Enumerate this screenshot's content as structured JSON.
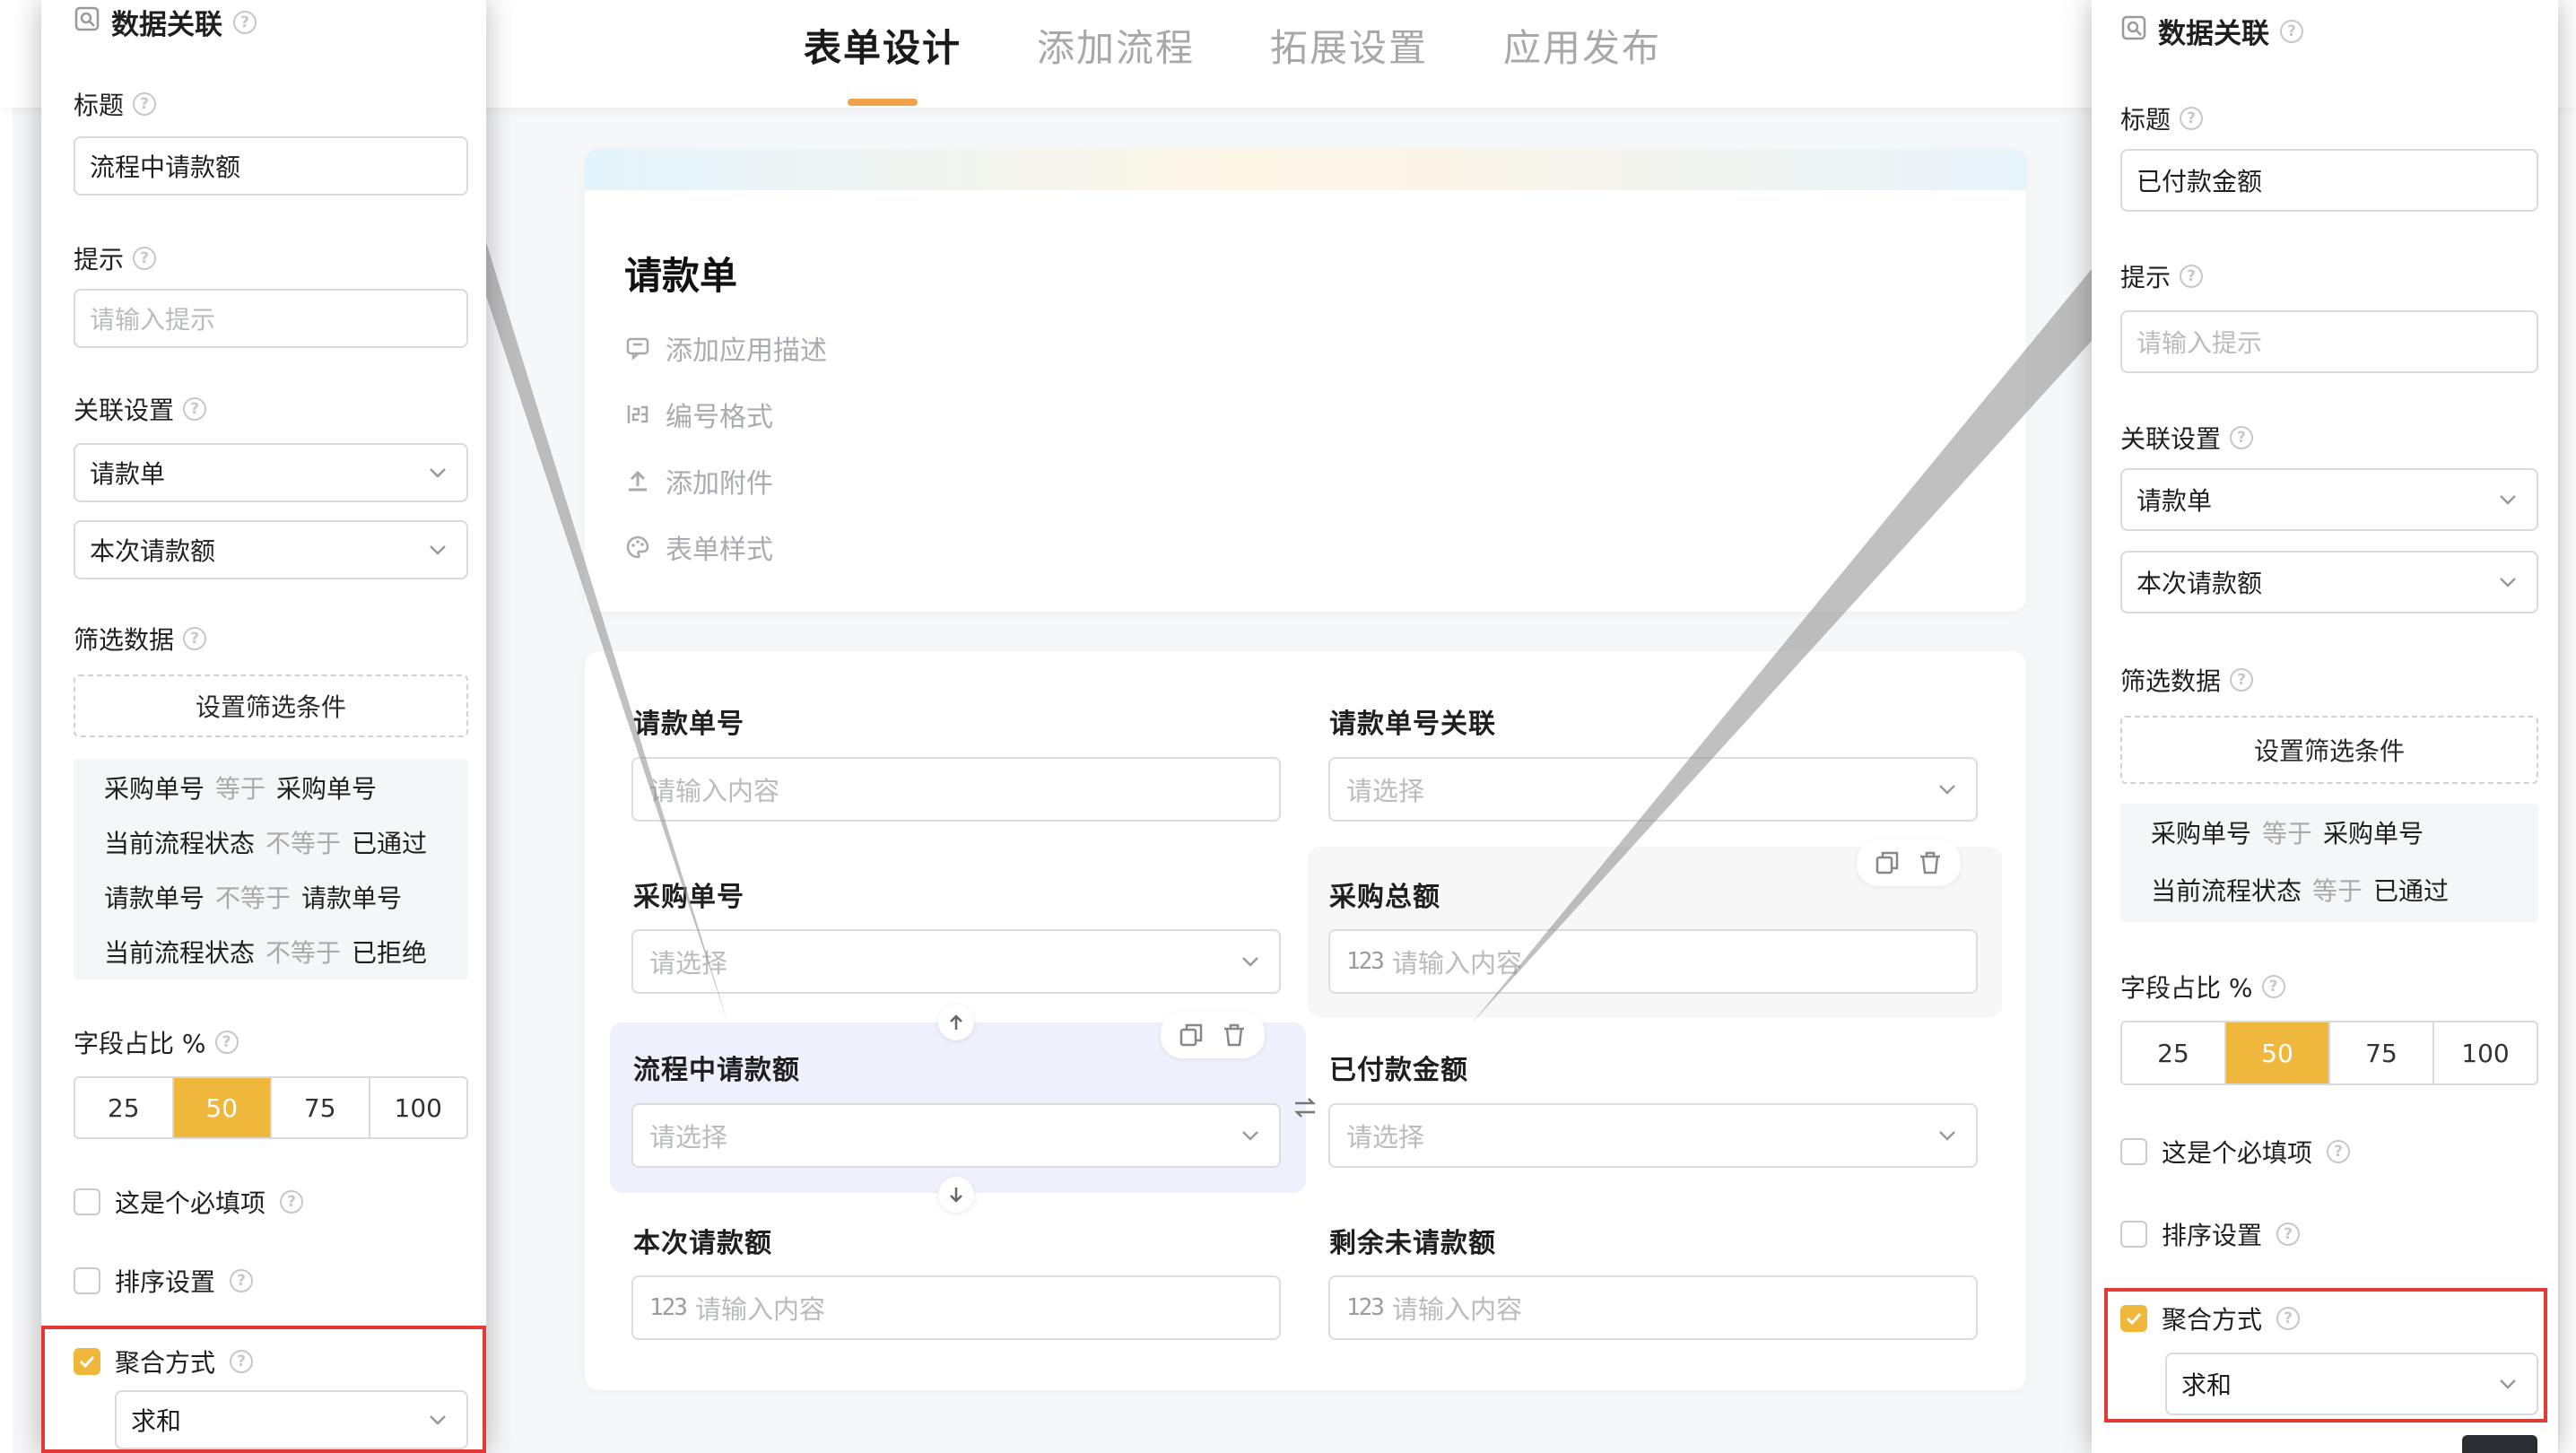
{
  "tabs": [
    {
      "label": "表单设计",
      "active": true
    },
    {
      "label": "添加流程",
      "active": false
    },
    {
      "label": "拓展设置",
      "active": false
    },
    {
      "label": "应用发布",
      "active": false
    }
  ],
  "form_header": {
    "title": "请款单",
    "options": [
      {
        "icon": "comment-icon",
        "label": "添加应用描述"
      },
      {
        "icon": "number-format-icon",
        "label": "编号格式"
      },
      {
        "icon": "upload-icon",
        "label": "添加附件"
      },
      {
        "icon": "palette-icon",
        "label": "表单样式"
      }
    ]
  },
  "form_fields": [
    {
      "label": "请款单号",
      "placeholder": "请输入内容",
      "kind": "text"
    },
    {
      "label": "请款单号关联",
      "placeholder": "请选择",
      "kind": "select"
    },
    {
      "label": "采购单号",
      "placeholder": "请选择",
      "kind": "select"
    },
    {
      "label": "采购总额",
      "placeholder": "请输入内容",
      "kind": "number"
    },
    {
      "label": "流程中请款额",
      "placeholder": "请选择",
      "kind": "select"
    },
    {
      "label": "已付款金额",
      "placeholder": "请选择",
      "kind": "select"
    },
    {
      "label": "本次请款额",
      "placeholder": "请输入内容",
      "kind": "number"
    },
    {
      "label": "剩余未请款额",
      "placeholder": "请输入内容",
      "kind": "number"
    }
  ],
  "panel_left": {
    "title": "数据关联",
    "title_label": "标题",
    "title_value": "流程中请款额",
    "hint_label": "提示",
    "hint_placeholder": "请输入提示",
    "assoc_label": "关联设置",
    "assoc_form": "请款单",
    "assoc_field": "本次请款额",
    "filter_label": "筛选数据",
    "filter_button": "设置筛选条件",
    "filters": [
      {
        "field": "采购单号",
        "op": "等于",
        "value": "采购单号"
      },
      {
        "field": "当前流程状态",
        "op": "不等于",
        "value": "已通过"
      },
      {
        "field": "请款单号",
        "op": "不等于",
        "value": "请款单号"
      },
      {
        "field": "当前流程状态",
        "op": "不等于",
        "value": "已拒绝"
      }
    ],
    "ratio_label": "字段占比 %",
    "ratio_options": [
      "25",
      "50",
      "75",
      "100"
    ],
    "ratio_selected": "50",
    "required_label": "这是个必填项",
    "required_checked": false,
    "sort_label": "排序设置",
    "sort_checked": false,
    "agg_label": "聚合方式",
    "agg_checked": true,
    "agg_value": "求和"
  },
  "panel_right": {
    "title": "数据关联",
    "title_label": "标题",
    "title_value": "已付款金额",
    "hint_label": "提示",
    "hint_placeholder": "请输入提示",
    "assoc_label": "关联设置",
    "assoc_form": "请款单",
    "assoc_field": "本次请款额",
    "filter_label": "筛选数据",
    "filter_button": "设置筛选条件",
    "filters": [
      {
        "field": "采购单号",
        "op": "等于",
        "value": "采购单号"
      },
      {
        "field": "当前流程状态",
        "op": "等于",
        "value": "已通过"
      }
    ],
    "ratio_label": "字段占比 %",
    "ratio_options": [
      "25",
      "50",
      "75",
      "100"
    ],
    "ratio_selected": "50",
    "required_label": "这是个必填项",
    "required_checked": false,
    "sort_label": "排序设置",
    "sort_checked": false,
    "agg_label": "聚合方式",
    "agg_checked": true,
    "agg_value": "求和"
  },
  "colors": {
    "accent": "#f0b73d",
    "tab_underline": "#f0a24b",
    "highlight_border": "#e53935",
    "selected_field_bg": "#eef0fb"
  }
}
